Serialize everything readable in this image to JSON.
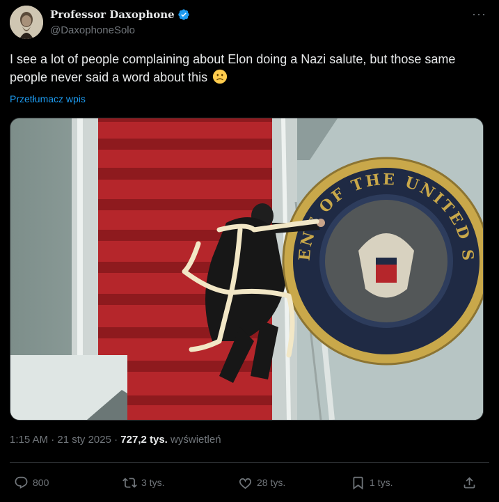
{
  "author": {
    "display_name": "Professor Daxophone",
    "handle": "@DaxophoneSolo"
  },
  "tweet": {
    "text": "I see a lot of people complaining about Elon doing a Nazi salute, but those same people never said a word about this",
    "emoji": "slightly-frowning-face",
    "translate_label": "Przetłumacz wpis"
  },
  "media": {
    "seal_text": "ENT OF THE UNITED STATES"
  },
  "meta": {
    "time": "1:15 AM",
    "date": "21 sty 2025",
    "views": "727,2 tys.",
    "views_label": "wyświetleń"
  },
  "actions": {
    "replies": "800",
    "reposts": "3 tys.",
    "likes": "28 tys.",
    "bookmarks": "1 tys."
  },
  "colors": {
    "background": "#000000",
    "text": "#e7e9ea",
    "muted": "#71767b",
    "link": "#1d9bf0",
    "verified": "#1d9bf0"
  }
}
